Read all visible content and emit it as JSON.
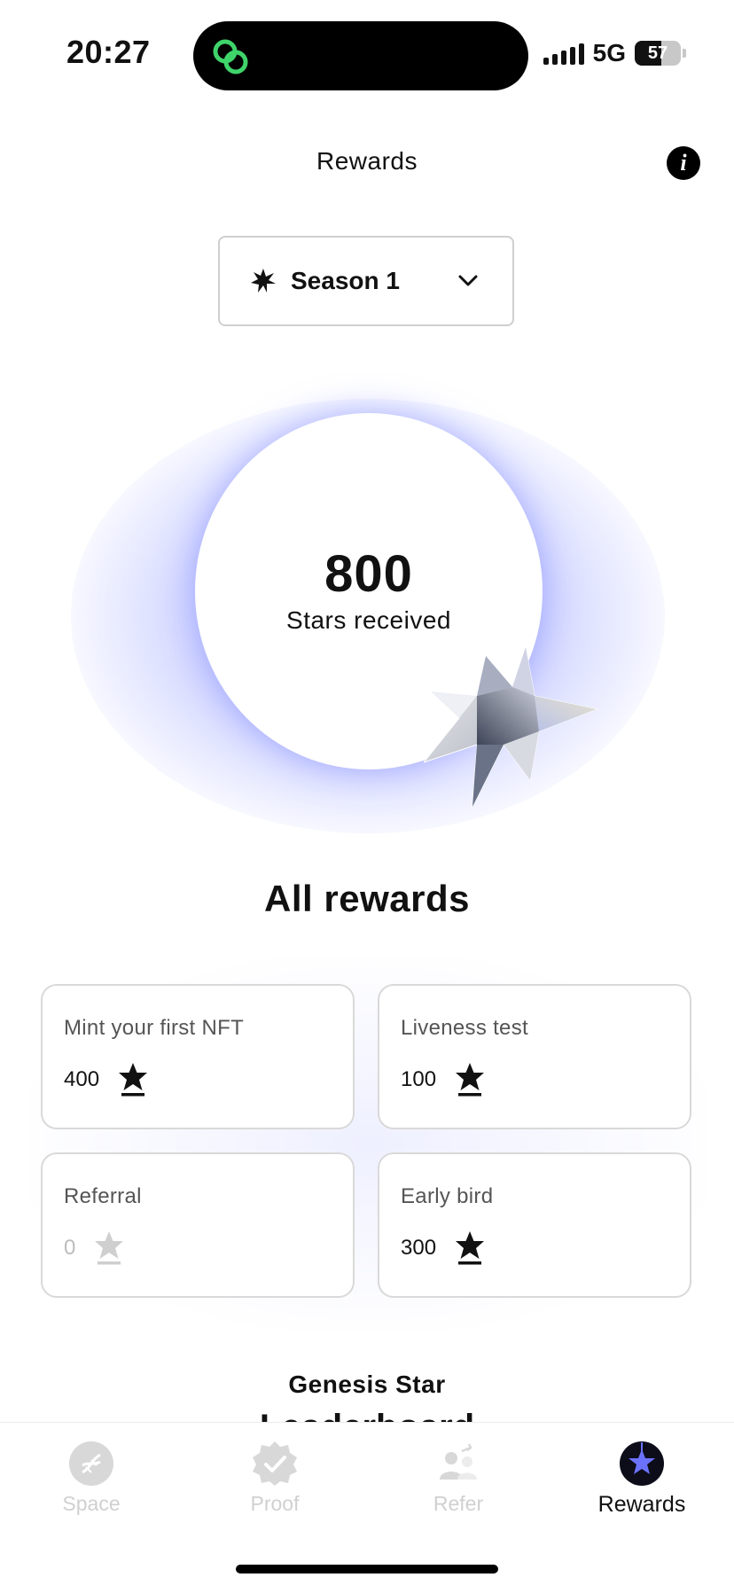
{
  "status_bar": {
    "time": "20:27",
    "network": "5G",
    "battery_percent": "57",
    "battery_level": 0.57,
    "dynamic_island_icon": "link-rings-icon"
  },
  "header": {
    "title": "Rewards",
    "info_icon": "info-icon"
  },
  "season_selector": {
    "label": "Season 1",
    "icon": "star-burst-icon",
    "chevron": "chevron-down-icon"
  },
  "summary": {
    "stars_value": "800",
    "stars_label": "Stars received"
  },
  "all_rewards": {
    "title": "All rewards",
    "cards": [
      {
        "title": "Mint your first NFT",
        "value": "400",
        "enabled": true
      },
      {
        "title": "Liveness test",
        "value": "100",
        "enabled": true
      },
      {
        "title": "Referral",
        "value": "0",
        "enabled": false
      },
      {
        "title": "Early bird",
        "value": "300",
        "enabled": true
      }
    ]
  },
  "leaderboard": {
    "subtitle": "Genesis Star",
    "title": "Leaderboard"
  },
  "tab_bar": {
    "tabs": [
      {
        "label": "Space",
        "icon": "dna-icon",
        "active": false
      },
      {
        "label": "Proof",
        "icon": "check-badge-icon",
        "active": false
      },
      {
        "label": "Refer",
        "icon": "people-share-icon",
        "active": false
      },
      {
        "label": "Rewards",
        "icon": "star-rewards-icon",
        "active": true
      }
    ]
  },
  "colors": {
    "accent": "#6b72ff",
    "glow": "#8c96ff",
    "inactive": "#d0d0d0"
  }
}
